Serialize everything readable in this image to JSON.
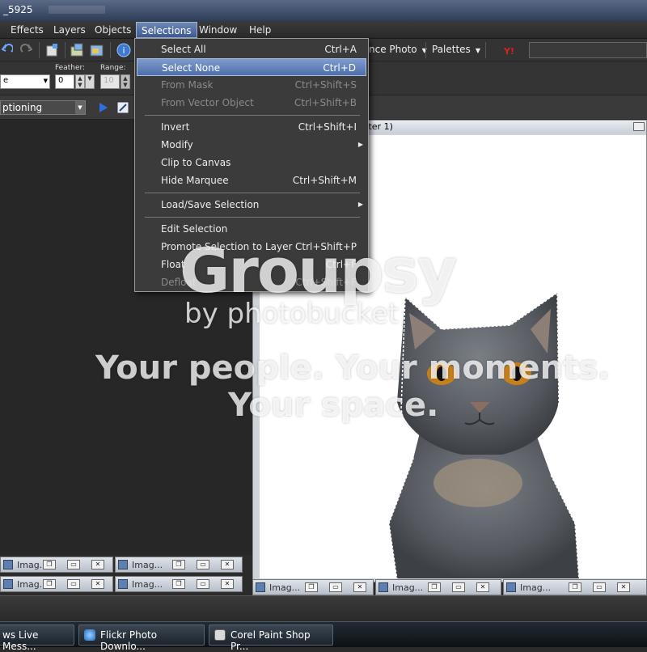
{
  "window": {
    "title": "_5925"
  },
  "menubar": [
    "Effects",
    "Layers",
    "Objects",
    "Selections",
    "Window",
    "Help"
  ],
  "toolbar": {
    "enhance_photo": "nce Photo",
    "palettes": "Palettes",
    "feather_label": "Feather:",
    "feather_value": "0",
    "range_label": "Range:",
    "range_value": "10",
    "mode_value": "e",
    "script_combo": "ptioning"
  },
  "selections_menu": {
    "items": [
      {
        "label": "Select All",
        "shortcut": "Ctrl+A"
      },
      {
        "label": "Select None",
        "shortcut": "Ctrl+D"
      },
      {
        "label": "From Mask",
        "shortcut": "Ctrl+Shift+S"
      },
      {
        "label": "From Vector Object",
        "shortcut": "Ctrl+Shift+B"
      },
      {
        "label": "Invert",
        "shortcut": "Ctrl+Shift+I"
      },
      {
        "label": "Modify",
        "shortcut": ""
      },
      {
        "label": "Clip to Canvas",
        "shortcut": ""
      },
      {
        "label": "Hide Marquee",
        "shortcut": "Ctrl+Shift+M"
      },
      {
        "label": "Load/Save Selection",
        "shortcut": ""
      },
      {
        "label": "Edit Selection",
        "shortcut": ""
      },
      {
        "label": "Promote Selection to Layer",
        "shortcut": "Ctrl+Shift+P"
      },
      {
        "label": "Float",
        "shortcut": "Ctrl+F"
      },
      {
        "label": "Defloat",
        "shortcut": "Ctrl+Shift+F"
      }
    ]
  },
  "image_window": {
    "title": "aster 1)"
  },
  "minimized_tab_label": "Imag...",
  "watermark": {
    "brand": "Groupsy",
    "by": "by photobucket",
    "line1": "Your people. Your moments.",
    "line2": "Your space."
  },
  "taskbar": {
    "tasks": [
      "ws Live Mess...",
      "Flickr Photo Downlo...",
      "Corel Paint Shop Pr..."
    ]
  },
  "colors": {
    "menu_highlight": "#5b7ab6",
    "titlebar": "#2e3d57"
  }
}
